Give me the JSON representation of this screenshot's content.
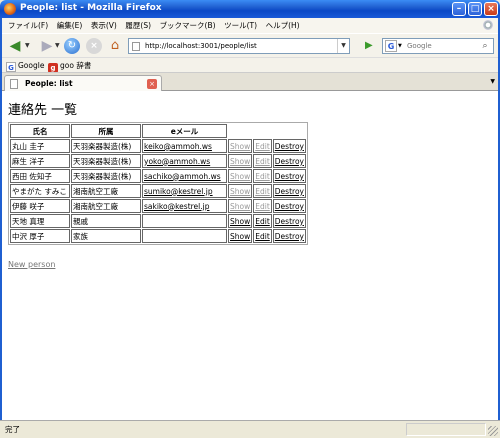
{
  "window": {
    "title": "People: list - Mozilla Firefox"
  },
  "menu": [
    "ファイル(F)",
    "編集(E)",
    "表示(V)",
    "履歴(S)",
    "ブックマーク(B)",
    "ツール(T)",
    "ヘルプ(H)"
  ],
  "nav": {
    "url": "http://localhost:3001/people/list",
    "search_placeholder": "Google"
  },
  "bookmarks": [
    "Google",
    "goo 辞書"
  ],
  "tab": {
    "label": "People: list"
  },
  "page": {
    "heading": "連絡先 一覧",
    "columns": [
      "氏名",
      "所属",
      "eメール"
    ],
    "rows": [
      {
        "name": "丸山 圭子",
        "org": "天羽楽器製造(株)",
        "email": "keiko@ammoh.ws",
        "show": "Show",
        "edit": "Edit",
        "destroy": "Destroy"
      },
      {
        "name": "麻生 洋子",
        "org": "天羽楽器製造(株)",
        "email": "yoko@ammoh.ws",
        "show": "Show",
        "edit": "Edit",
        "destroy": "Destroy"
      },
      {
        "name": "西田 佐知子",
        "org": "天羽楽器製造(株)",
        "email": "sachiko@ammoh.ws",
        "show": "Show",
        "edit": "Edit",
        "destroy": "Destroy"
      },
      {
        "name": "やまがた すみこ",
        "org": "湘南航空工廠",
        "email": "sumiko@kestrel.jp",
        "show": "Show",
        "edit": "Edit",
        "destroy": "Destroy"
      },
      {
        "name": "伊藤 咲子",
        "org": "湘南航空工廠",
        "email": "sakiko@kestrel.jp",
        "show": "Show",
        "edit": "Edit",
        "destroy": "Destroy"
      },
      {
        "name": "天地 真理",
        "org": "親戚",
        "email": "",
        "show": "Show",
        "edit": "Edit",
        "destroy": "Destroy"
      },
      {
        "name": "中沢 厚子",
        "org": "家族",
        "email": "",
        "show": "Show",
        "edit": "Edit",
        "destroy": "Destroy"
      }
    ],
    "new_link": "New person"
  },
  "status": {
    "text": "完了"
  }
}
